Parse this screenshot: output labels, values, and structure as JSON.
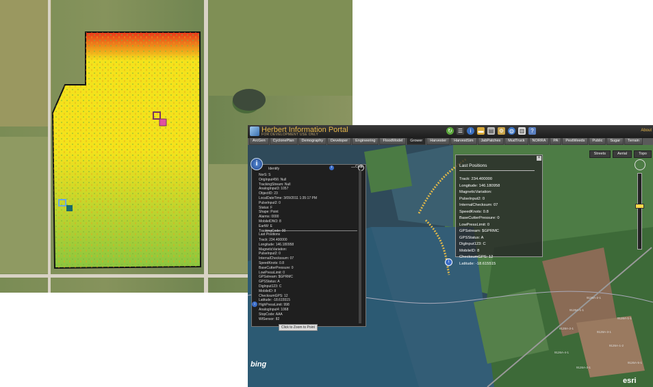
{
  "portal": {
    "title": "Herbert Information Portal",
    "subtitle": "FOR DEVELOPMENT USE ONLY",
    "about": "About",
    "tabs": [
      "ArcGen",
      "CyclonePlan",
      "Demography",
      "Developer",
      "Engineering",
      "FloodModel",
      "Grower",
      "Harvester",
      "HarvestSim",
      "JabPatches",
      "MudTruck",
      "NORRA",
      "PA",
      "PestWeeds",
      "Public",
      "Sugar",
      "Terrain"
    ],
    "active_tab": "Grower",
    "basemaps": [
      "Streets",
      "Aerial",
      "Topo"
    ]
  },
  "identify": {
    "header": "Identify",
    "clear": "Clear",
    "props": [
      "NorS: S",
      "OrigInput456: Null",
      "TrackingStream: Null",
      "AnalogInput3: 1057",
      "ObjectID: 23",
      "LocalDateTime: 3/09/2011 1:35:17 PM",
      "PulseInput2: 0",
      "Status: F",
      "Shape: Point",
      "Alarms: 0000",
      "MobileIDNO: 8",
      "EartW: E",
      "TrackingCode: 00"
    ],
    "section_title": "Last Positions",
    "positions": [
      "Track: 234.400000",
      "Longitude: 146.180958",
      "MagneticVariation:",
      "PulseInput2: 0",
      "InternalCheckssum: 07",
      "SpeedKnots: 0.8",
      "BaseCutterPressure: 0",
      "LowPressLimit: 0",
      "GPSstream: $GPRMC",
      "GPSStatus: A",
      "DigInput123: C",
      "MobileID: 8",
      "ChecksumGPS: 12",
      "Latitude: -18.615515",
      "HighPressLimit: 998",
      "AnalogInput4: 1068",
      "StopCode: AAA",
      "WtSensor: 82"
    ],
    "zoom_tooltip": "Click to Zoom to Point"
  },
  "last_positions": {
    "title": "Last Positions",
    "lines": [
      "Track: 234.400000",
      "Longitude: 146.180958",
      "MagneticVariation:",
      "PulseInput2: 0",
      "InternalChecksum: 07",
      "SpeedKnots: 0.8",
      "BaseCutterPressure: 0",
      "LowPressLimit: 0",
      "GPSstream: $GPRMC",
      "GPSStatus: A",
      "DigInput123: C",
      "MobileID: 8",
      "ChecksumGPS: 12",
      "Latitude: -18.615515"
    ]
  },
  "map": {
    "bing_logo": "bing",
    "esri_logo": "esri",
    "lot_labels": [
      "9128A-1-1",
      "9128A-2-1",
      "9128A-3-1",
      "9126A-1-1",
      "9126A-2-1",
      "9126A-1-2",
      "9126A-4-1",
      "9126A-5-1",
      "9126A-3-1"
    ]
  },
  "colors": {
    "header_text": "#e8b84a",
    "heat_high": "#e8351a",
    "heat_mid": "#f4e21c",
    "heat_low": "#8cc63f"
  }
}
